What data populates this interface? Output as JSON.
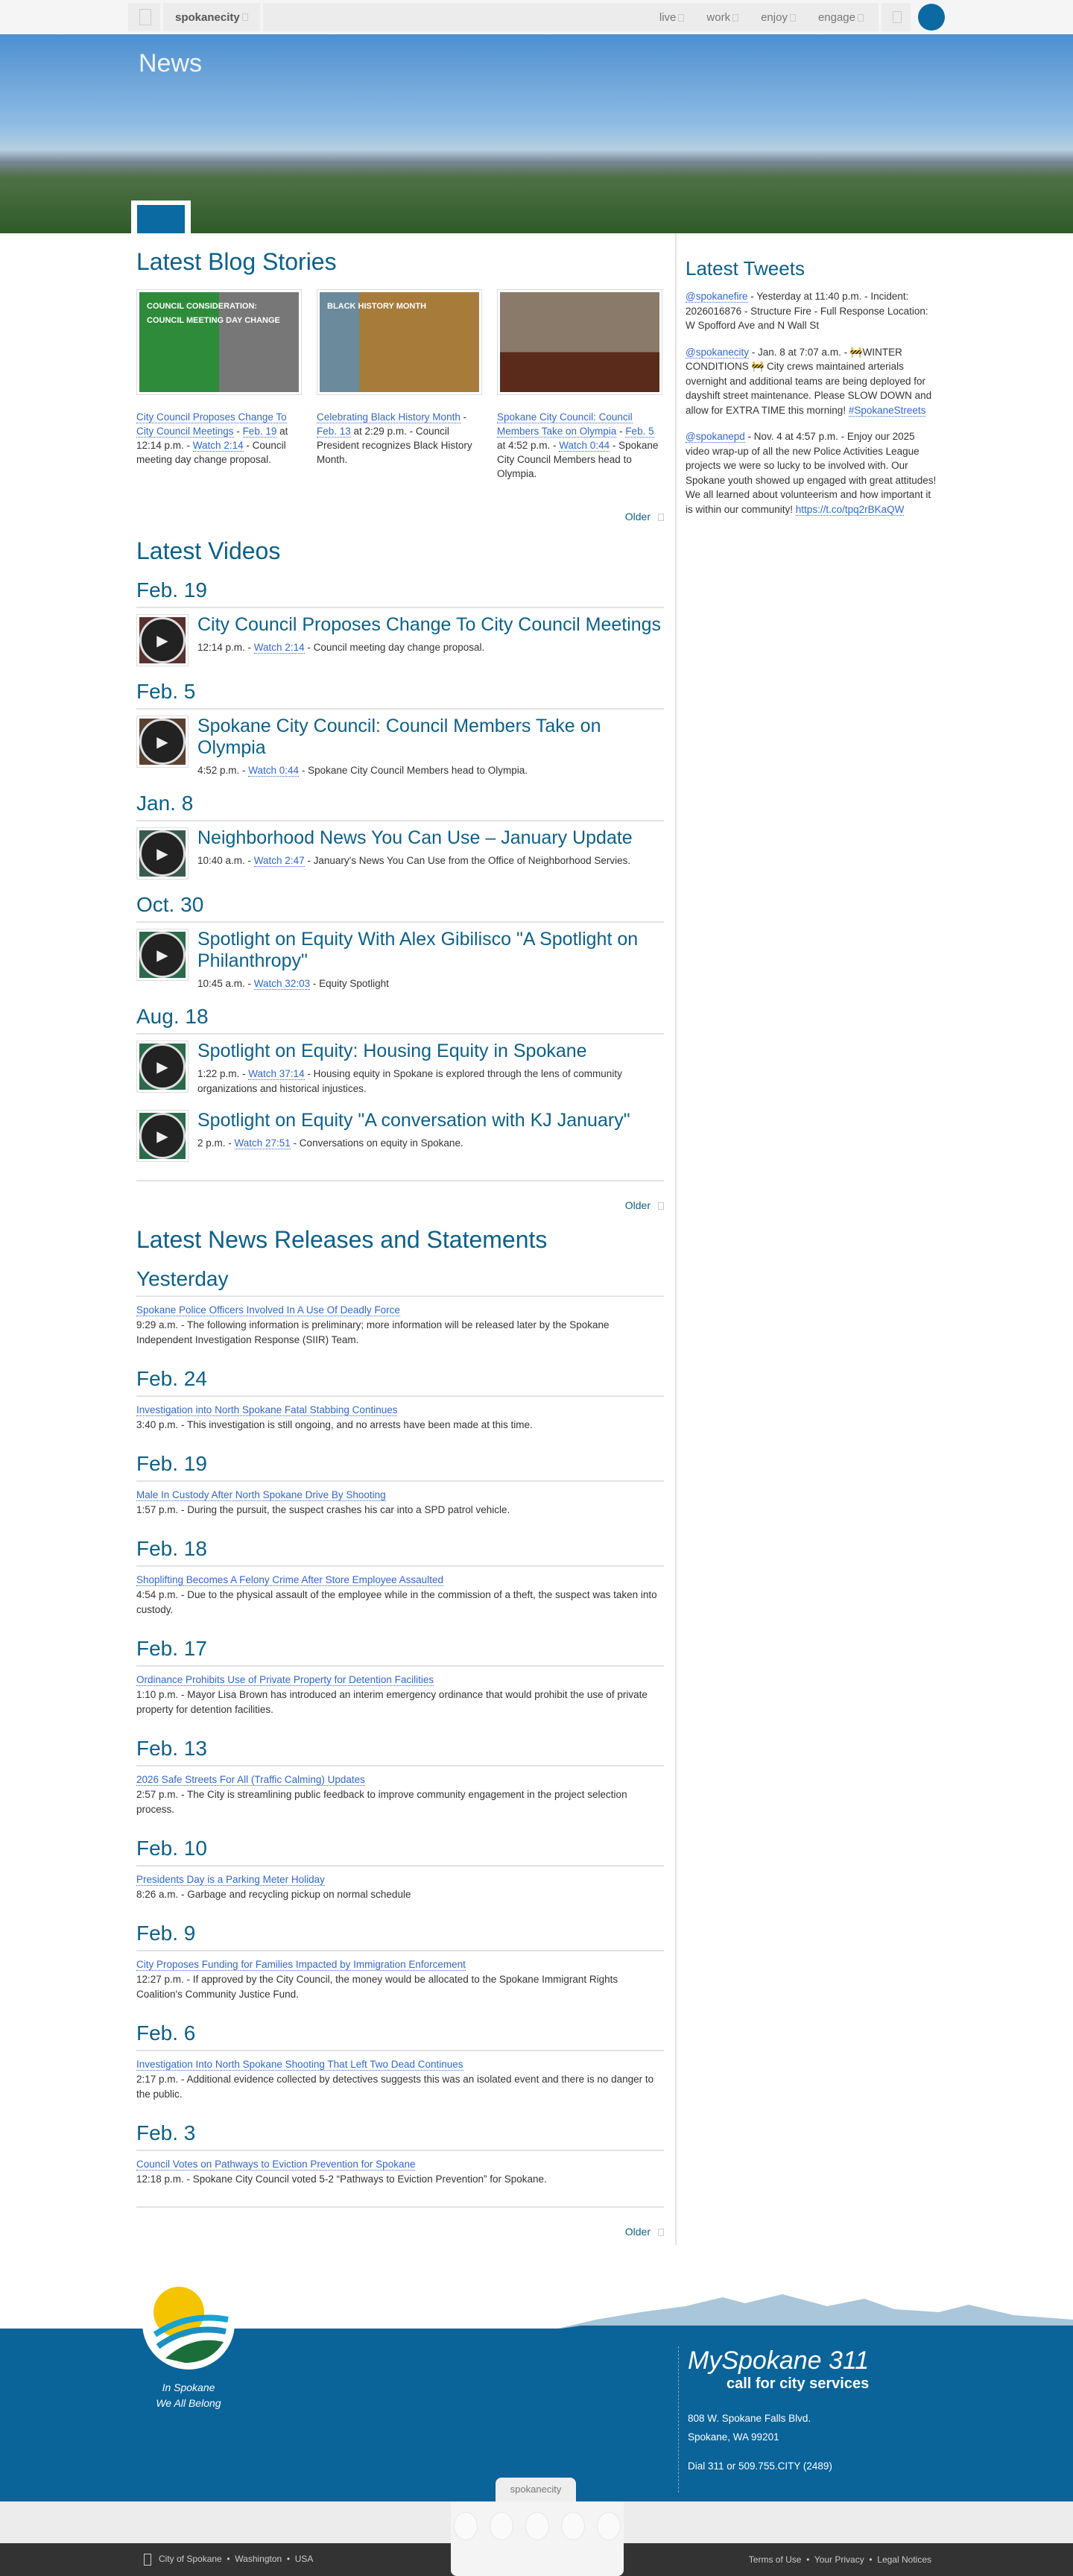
{
  "nav": {
    "brand": "spokanecity",
    "items": [
      "live",
      "work",
      "enjoy",
      "engage"
    ]
  },
  "hero": {
    "title": "News"
  },
  "blog": {
    "heading": "Latest Blog Stories",
    "older": "Older",
    "stories": [
      {
        "title": "City Council Proposes Change To City Council Meetings",
        "date": "Feb. 19",
        "time": " at 12:14 p.m. - ",
        "watch": "Watch 2:14",
        "desc": " - Council meeting day change proposal.",
        "img_text": "COUNCIL CONSIDERATION: COUNCIL MEETING DAY CHANGE"
      },
      {
        "title": "Celebrating Black History Month",
        "date": "Feb. 13",
        "time": " at 2:29 p.m.",
        "watch": "",
        "desc": " - Council President recognizes Black History Month.",
        "img_text": "BLACK HISTORY MONTH"
      },
      {
        "title": "Spokane City Council: Council Members Take on Olympia",
        "date": "Feb. 5",
        "time": " at 4:52 p.m. - ",
        "watch": "Watch 0:44",
        "desc": " - Spokane City Council Members head to Olympia.",
        "img_text": ""
      }
    ]
  },
  "videos": {
    "heading": "Latest Videos",
    "older": "Older",
    "groups": [
      {
        "date": "Feb. 19",
        "items": [
          {
            "title": "City Council Proposes Change To City Council Meetings",
            "time": "12:14 p.m. - ",
            "watch": "Watch 2:14",
            "desc": " - Council meeting day change proposal."
          }
        ]
      },
      {
        "date": "Feb. 5",
        "items": [
          {
            "title": "Spokane City Council: Council Members Take on Olympia",
            "time": "4:52 p.m. - ",
            "watch": "Watch 0:44",
            "desc": " - Spokane City Council Members head to Olympia."
          }
        ]
      },
      {
        "date": "Jan. 8",
        "items": [
          {
            "title": "Neighborhood News You Can Use – January Update",
            "time": "10:40 a.m. - ",
            "watch": "Watch 2:47",
            "desc": " - January's News You Can Use from the Office of Neighborhood Servies."
          }
        ]
      },
      {
        "date": "Oct. 30",
        "items": [
          {
            "title": "Spotlight on Equity With Alex Gibilisco \"A Spotlight on Philanthropy\"",
            "time": "10:45 a.m. - ",
            "watch": "Watch 32:03",
            "desc": " - Equity Spotlight"
          }
        ]
      },
      {
        "date": "Aug. 18",
        "items": [
          {
            "title": "Spotlight on Equity: Housing Equity in Spokane",
            "time": "1:22 p.m. - ",
            "watch": "Watch 37:14",
            "desc": " - Housing equity in Spokane is explored through the lens of community organizations and historical injustices."
          },
          {
            "title": "Spotlight on Equity \"A conversation with KJ January\"",
            "time": "2 p.m. - ",
            "watch": "Watch 27:51",
            "desc": " - Conversations on equity in Spokane."
          }
        ]
      }
    ]
  },
  "news": {
    "heading": "Latest News Releases and Statements",
    "older": "Older",
    "groups": [
      {
        "date": "Yesterday",
        "title": "Spokane Police Officers Involved In A Use Of Deadly Force",
        "text": "9:29 a.m. - The following information is preliminary; more information will be released later by the Spokane Independent Investigation Response (SIIR) Team."
      },
      {
        "date": "Feb. 24",
        "title": "Investigation into North Spokane Fatal Stabbing Continues",
        "text": "3:40 p.m. - This investigation is still ongoing, and no arrests have been made at this time."
      },
      {
        "date": "Feb. 19",
        "title": "Male In Custody After North Spokane Drive By Shooting",
        "text": "1:57 p.m. - During the pursuit, the suspect crashes his car into a SPD patrol vehicle."
      },
      {
        "date": "Feb. 18",
        "title": "Shoplifting Becomes A Felony Crime After Store Employee Assaulted",
        "text": "4:54 p.m. - Due to the physical assault of the employee while in the commission of a theft, the suspect was taken into custody."
      },
      {
        "date": "Feb. 17",
        "title": "Ordinance Prohibits Use of Private Property for Detention Facilities",
        "text": "1:10 p.m. - Mayor Lisa Brown has introduced an interim emergency ordinance that would prohibit the use of private property for detention facilities."
      },
      {
        "date": "Feb. 13",
        "title": "2026 Safe Streets For All (Traffic Calming) Updates",
        "text": "2:57 p.m. - The City is streamlining public feedback to improve community engagement in the project selection process."
      },
      {
        "date": "Feb. 10",
        "title": "Presidents Day is a Parking Meter Holiday",
        "text": "8:26 a.m. - Garbage and recycling pickup on normal schedule"
      },
      {
        "date": "Feb. 9",
        "title": "City Proposes Funding for Families Impacted by Immigration Enforcement",
        "text": "12:27 p.m. - If approved by the City Council, the money would be allocated to the Spokane Immigrant Rights Coalition's Community Justice Fund."
      },
      {
        "date": "Feb. 6",
        "title": "Investigation Into North Spokane Shooting That Left Two Dead Continues",
        "text": "2:17 p.m. - Additional evidence collected by detectives suggests this was an isolated event and there is no danger to the public."
      },
      {
        "date": "Feb. 3",
        "title": "Council Votes on Pathways to Eviction Prevention for Spokane",
        "text": "12:18 p.m. - Spokane City Council voted 5-2 “Pathways to Eviction Prevention” for Spokane."
      }
    ]
  },
  "tweets": {
    "heading": "Latest Tweets",
    "items": [
      {
        "handle": "@spokanefire",
        "text": " - Yesterday at 11:40 p.m. - Incident: 2026016876 - Structure Fire - Full Response Location: W Spofford Ave and N Wall St",
        "link": ""
      },
      {
        "handle": "@spokanecity",
        "text": " - Jan. 8 at 7:07 a.m. - 🚧WINTER CONDITIONS 🚧 City crews maintained arterials overnight and additional teams are being deployed for dayshift street maintenance. Please SLOW DOWN and allow for EXTRA TIME this morning! ",
        "link": "#SpokaneStreets"
      },
      {
        "handle": "@spokanepd",
        "text": " - Nov. 4 at 4:57 p.m. - Enjoy our 2025 video wrap-up of all the new Police Activities League projects we were so lucky to be involved with. Our Spokane youth showed up engaged with great attitudes! We all learned about volunteerism and how important it is within our community! ",
        "link": "https://t.co/tpq2rBKaQW"
      }
    ]
  },
  "footer": {
    "tagline1": "In Spokane",
    "tagline2": "We All Belong",
    "brand311": "MySpokane 311",
    "brand311_sub": "call for city services",
    "address1": "808 W. Spokane Falls Blvd.",
    "address2": "Spokane, WA 99201",
    "phone": "Dial 311 or 509.755.CITY (2489)",
    "tab": "spokanecity",
    "left_links": [
      "City of Spokane",
      "Washington",
      "USA"
    ],
    "right_links": [
      "Terms of Use",
      "Your Privacy",
      "Legal Notices"
    ]
  },
  "colors": {
    "accent": "#0d6089",
    "link": "#3366cc",
    "footer_blue": "#0a6399"
  }
}
